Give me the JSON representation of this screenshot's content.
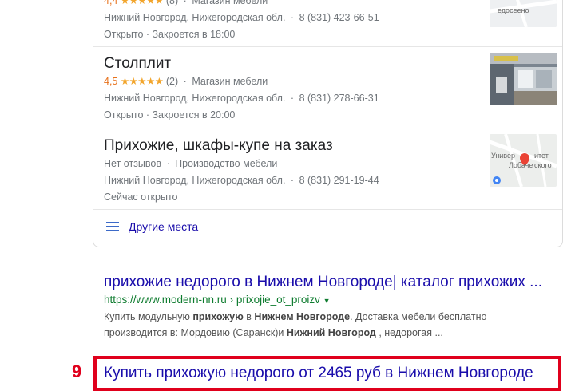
{
  "places": [
    {
      "name": "",
      "rating": "4,4",
      "stars": "★★★★★",
      "reviews": "(8)",
      "category": "Магазин мебели",
      "address": "Нижний Новгород, Нижегородская обл.",
      "phone": "8 (831) 423-66-51",
      "hours": "Открыто · Закроется в 18:00",
      "thumb_text": "едосеено"
    },
    {
      "name": "Столплит",
      "rating": "4,5",
      "stars": "★★★★★",
      "reviews": "(2)",
      "category": "Магазин мебели",
      "address": "Нижний Новгород, Нижегородская обл.",
      "phone": "8 (831) 278-66-31",
      "hours": "Открыто · Закроется в 20:00",
      "thumb_text": ""
    },
    {
      "name": "Прихожие, шкафы-купе на заказ",
      "no_reviews": "Нет отзывов",
      "category": "Производство мебели",
      "address": "Нижний Новгород, Нижегородская обл.",
      "phone": "8 (831) 291-19-44",
      "hours": "Сейчас открыто",
      "thumb_text_1": "Универ",
      "thumb_text_2": "итет",
      "thumb_text_3": "Лобаче",
      "thumb_text_4": "ского"
    }
  ],
  "more_places_label": "Другие места",
  "result_8": {
    "title": "прихожие недорого в Нижнем Новгороде| каталог прихожих ...",
    "url": "https://www.modern-nn.ru",
    "breadcrumb": "› prixojie_ot_proizv",
    "snippet_line1_a": "Купить модульную ",
    "snippet_line1_b": "прихожую",
    "snippet_line1_c": " в ",
    "snippet_line1_d": "Нижнем Новгороде",
    "snippet_line1_e": ". Доставка мебели бесплатно",
    "snippet_line2_a": "производится в: Мордовию (Саранск)и ",
    "snippet_line2_b": "Нижний Новгород",
    "snippet_line2_c": " , недорогая ..."
  },
  "result_9": {
    "rank": "9",
    "title": "Купить прихожую недорого от 2465 руб в Нижнем Новгороде"
  },
  "colors": {
    "link": "#1a0dab",
    "url_green": "#0d7b2e",
    "rating_orange": "#e7711b",
    "highlight_red": "#e0001c"
  }
}
